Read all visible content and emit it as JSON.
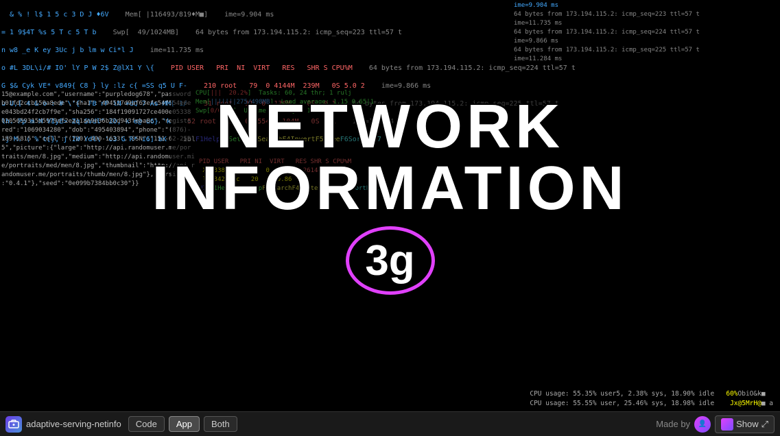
{
  "title": {
    "line1": "NETWORK",
    "line2": "INFORMATION"
  },
  "badge": {
    "label": "3g"
  },
  "bottom_bar": {
    "app_name": "adaptive-serving-netinfo",
    "tabs": [
      {
        "id": "code",
        "label": "Code",
        "active": false
      },
      {
        "id": "app",
        "label": "App",
        "active": true
      },
      {
        "id": "both",
        "label": "Both",
        "active": false
      }
    ],
    "made_by": "Made by",
    "show_label": "Show"
  },
  "terminal": {
    "left_col": "15@example.com\",\"username\":\"purpledog678\",\"password\"\nb01fd2ccb150a8ede\",\"sha1\":\"494527d9af63efc54f554e6e\ne043bd24f2cb7f9e\",\"sha256\":\"184f19091727ce400e05338\n0205659315d5979af2ea11ae9e36b32d943feba8c\",\"registe\nred\":\"1069034280\",\"dob\":\"495403894\",\"phone\":\"(876)-\n189-5815\",\"cell\":\"(720)-400-1633\",\"SSN\":\"151-62-258\n5\",\"picture\":{\"large\":\"http://api.randomuser.me/por\ntraits/men/8.jpg\",\"medium\":\"http://api.randomuser.mi\ne/portraits/med/men/8.jpg\",\"thumbnail\":\"http://api.r\nandomuser.me/portraits/thumb/men/8.jpg\"},\"version\"\n:\"0.4.1\"},\"seed\":\"0e099b7384bb0c30\"}}",
    "right_col": "CPU usage: 55.35% user5, 2.38% sys, 18.90% idle\nCPU usage: 55.55% user, 25.46% sys, 18.98% idle"
  }
}
